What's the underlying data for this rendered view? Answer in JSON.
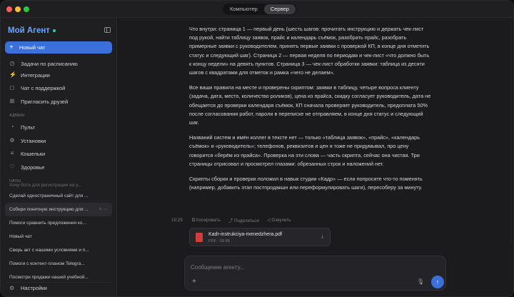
{
  "titlebar": {
    "tabs": [
      {
        "label": "Компьютер",
        "active": false
      },
      {
        "label": "Сервер",
        "active": true
      }
    ]
  },
  "sidebar": {
    "brand": "Мой Агент",
    "new_chat": "Новый чат",
    "items": [
      {
        "label": "Задачи по расписанию",
        "icon": "clock-icon"
      },
      {
        "label": "Интеграции",
        "icon": "plug-icon"
      },
      {
        "label": "Чат с поддержкой",
        "icon": "chat-icon"
      },
      {
        "label": "Пригласить друзей",
        "icon": "gift-icon"
      }
    ],
    "admin_label": "АДМИН",
    "admin_items": [
      {
        "label": "Пульт",
        "icon": "dashboard-icon"
      },
      {
        "label": "Установки",
        "icon": "gear-icon"
      },
      {
        "label": "Кошельки",
        "icon": "list-icon"
      },
      {
        "label": "Здоровье",
        "icon": "heart-icon"
      }
    ],
    "chats_label": "ЧАТЫ",
    "chats": [
      "Хочу бота для регистрации на у...",
      "Сделай одностраничный сайт для ...",
      "Собери понятную инструкцию для ...",
      "Помоги сравнить предложения ко...",
      "Новый чат",
      "Сверь акт с нашими условиями и п...",
      "Помоги с контент-планом Telegra...",
      "Посмотри продажи нашей учебной..."
    ],
    "settings": "Настройки"
  },
  "message": {
    "paragraphs": [
      "Что внутри: страница 1 — первый день (шесть шагов: прочитать инструкцию и держать чек-лист под рукой, найти таблицу заявок, прайс и календарь съёмок, разобрать прайс, разобрать примерные заявки с руководителем, принять первые заявки с проверкой КП, в конце дня отметить статус и следующий шаг). Страница 2 — первая неделя по периодам и чек-лист «что должно быть к концу недели» на девять пунктов. Страница 3 — чек-лист обработки заявки: таблица из десяти шагов с квадратами для отметок и рамка «чего не делаем».",
      "Все ваши правила на месте и проверены скриптом: заявки в таблицу, четыре вопроса клиенту (задача, дата, место, количество роликов), цена из прайса, скидку согласует руководитель, дата не обещается до проверки календаря съёмок, КП сначала проверяет руководитель, предоплата 50% после согласования работ, пароли в переписке не отправляем, в конце дня статус и следующий шаг.",
      "Названий систем и имён коллег в тексте нет — только «таблица заявок», «прайс», «календарь съёмок» и «руководитель»; телефонов, реквизитов и цен я тоже не придумывал, про цену говорится «берём из прайса». Проверка на эти слова — часть скрипта, сейчас она чистая. Три страницы отрисовал и просмотрел глазами: обрезанных строк и наложений нет.",
      "Скрипты сборки и проверки положил в навык студии «Кадр» — если попросите что-то поменять (например, добавить этап постпродакшн или переформулировать шаги), пересоберу за минуту."
    ],
    "time": "19:29",
    "actions": {
      "copy": "Копировать",
      "share": "Поделиться",
      "voice": "Озвучить"
    },
    "attachment": {
      "name": "Kadr-instrukciya-menedzhera.pdf",
      "meta": "PDF · 59 КБ"
    }
  },
  "composer": {
    "placeholder": "Сообщение агенту..."
  },
  "colors": {
    "accent": "#3b6fd9",
    "brand": "#6aa8ff",
    "online": "#34d399",
    "pdf": "#d03b3b"
  }
}
